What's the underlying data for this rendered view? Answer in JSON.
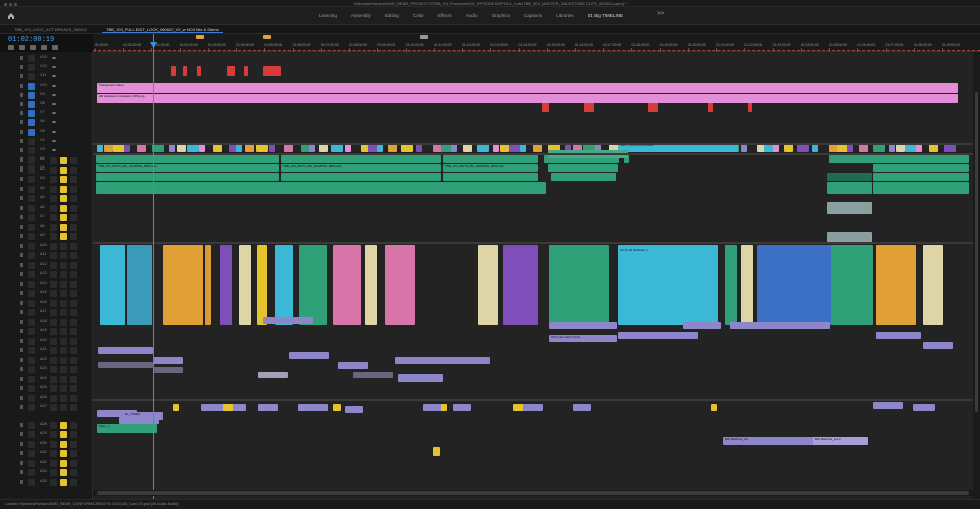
{
  "window": {
    "title": "/Volumes/Hobson/AVID_BEAR_PROJECTS/TBB_S3_Production/04_EPISODES/EP03/1_Cuts/TBB_303_MASTER_SALESTONE CUTS_062022.prproj *"
  },
  "workspaces": {
    "tabs": [
      "Learning",
      "Assembly",
      "Editing",
      "Color",
      "Effects",
      "Audio",
      "Graphics",
      "Captions",
      "Libraries",
      "01 Big TIMELINE"
    ],
    "active_index": 9,
    "more_label": ">>"
  },
  "sequence_tabs": [
    {
      "label": "TBB_103_LOCK_ACT BREAKS_062022",
      "active": false
    },
    {
      "label": "TBB_103_FULL EDIT_LOCK_060622_V2_w NO3 Mix & Stems",
      "active": true
    }
  ],
  "timecode": "01:02:00:19",
  "ruler": {
    "labels": [
      "01:00:00",
      "01:00:30:00",
      "01:01:00:00",
      "01:02:00:00",
      "01:03:00:00",
      "01:04:00:00",
      "01:05:00:00",
      "01:06:00:00",
      "01:07:00:00",
      "01:08:00:00",
      "01:09:00:00",
      "01:10:00:00",
      "01:11:00:00",
      "01:12:00:00",
      "01:13:00:00",
      "01:14:00:00",
      "01:15:00:00",
      "01:16:00:00",
      "01:17:00:00",
      "01:18:00:00",
      "01:19:00:00",
      "01:20:00:00",
      "01:21:00:00",
      "01:22:00:00",
      "01:23:00:00",
      "01:24:00:00",
      "01:25:00:00",
      "01:26:00:00",
      "01:27:00:00",
      "01:28:00:00",
      "01:29:00:00"
    ],
    "markers": [
      {
        "label": "",
        "color": "#d9a441"
      },
      {
        "label": "",
        "color": "#d9a441"
      },
      {
        "label": "",
        "color": "#999999"
      }
    ]
  },
  "video_tracks": [
    "V13",
    "V12",
    "V11",
    "V10",
    "V9",
    "V8",
    "V7",
    "V6",
    "V5",
    "V4",
    "V3",
    "V2",
    "V1"
  ],
  "audio_tracks": [
    "A1",
    "A2",
    "A3",
    "A4",
    "A5",
    "A6",
    "A7",
    "A8",
    "A9",
    "A10",
    "A11",
    "A12",
    "A13",
    "A14",
    "A15",
    "A16",
    "A17",
    "A18",
    "A19",
    "A20",
    "A21",
    "A22",
    "A23",
    "A24",
    "A25",
    "A26",
    "A27",
    "A28",
    "A29",
    "A30",
    "A31",
    "A32",
    "A33",
    "A34"
  ],
  "clips": {
    "transparent_video": "Transparent Video",
    "adjustment": "HR Heliocam & Academy 086.png",
    "interview_1": "TBB_103_INNT1_Mix_20220501_086b.wav",
    "interview_2": "TBB_103_INNT2_Mix_20220501_086b.wav",
    "interview_3": "TBB_103_INNT3_Mix_20220501_086b.wav",
    "nested": "NEST_3A-B-00 Multicam",
    "multicam": "3A-12 00 Multicam 2",
    "sfx": "SFX_New Tech Circle",
    "music_1": "Bell Machine_Act",
    "music_2": "Bell Machine_Act 2",
    "gfx": "DL_TIMER",
    "stem": "Stem_1"
  },
  "status": "Loaded /Volumes/Hobson/AVID_BEAR_CONFORM/CREDITS/ SOC03A_Card 10.psd [45 Audio Audio]",
  "colors": {
    "accent": "#3a8ee6",
    "clip_green": "#2fa078",
    "clip_pink": "#e28fd8",
    "clip_red": "#d93a3a",
    "clip_cyan": "#3bb8d6",
    "clip_purple": "#7e4fb8",
    "clip_yellow": "#e5c32a",
    "clip_lavender": "#8d86c9",
    "clip_orange": "#e0a035",
    "clip_pink_audio": "#d775a8"
  }
}
